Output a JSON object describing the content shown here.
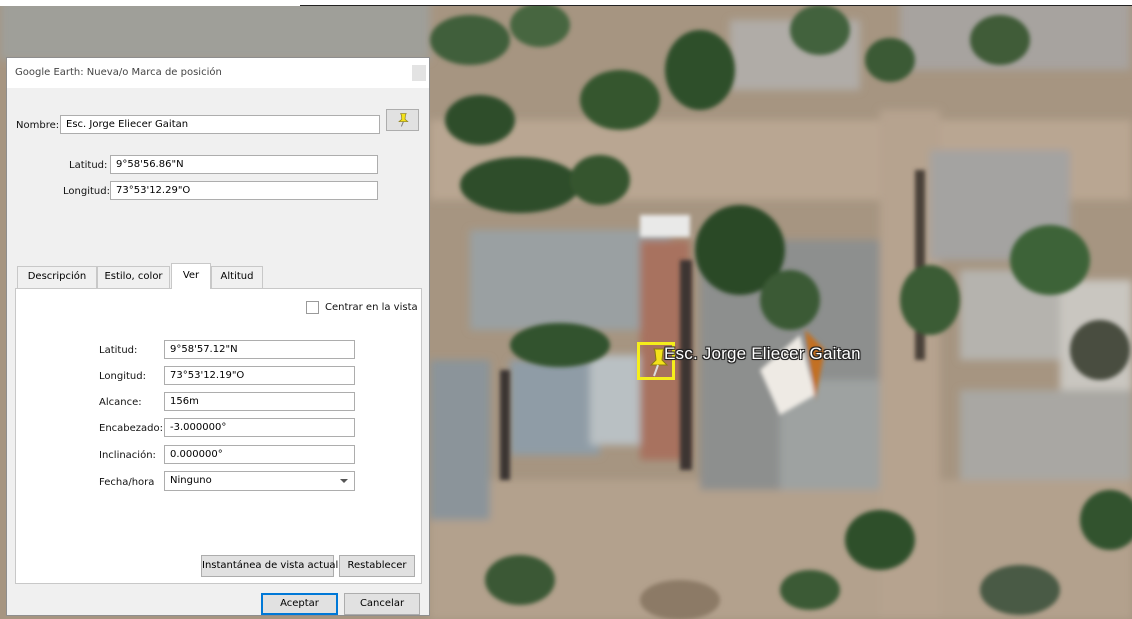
{
  "dialog": {
    "title": "Google Earth: Nueva/o Marca de posición",
    "name_label": "Nombre:",
    "name_value": "Esc. Jorge Eliecer Gaitan",
    "pin_icon": "yellow-pushpin-icon",
    "lat_label": "Latitud:",
    "lat_value": "9°58'56.86\"N",
    "lon_label": "Longitud:",
    "lon_value": "73°53'12.29\"O",
    "tabs": [
      {
        "label": "Descripción"
      },
      {
        "label": "Estilo, color"
      },
      {
        "label": "Ver"
      },
      {
        "label": "Altitud"
      }
    ],
    "active_tab": "Ver",
    "view": {
      "center_label": "Centrar en la vista",
      "center_checked": false,
      "lat_label": "Latitud:",
      "lat_value": "9°58'57.12\"N",
      "lon_label": "Longitud:",
      "lon_value": "73°53'12.19\"O",
      "range_label": "Alcance:",
      "range_value": "156m",
      "heading_label": "Encabezado:",
      "heading_value": "-3.000000°",
      "tilt_label": "Inclinación:",
      "tilt_value": "0.000000°",
      "datetime_label": "Fecha/hora",
      "datetime_value": "Ninguno",
      "snapshot_label": "Instantánea de vista actual",
      "reset_label": "Restablecer"
    },
    "ok_label": "Aceptar",
    "cancel_label": "Cancelar"
  },
  "map": {
    "placemark_label": "Esc. Jorge Eliecer Gaitan",
    "placemark_icon": "yellow-pushpin-icon",
    "highlight_color": "#f5ee1c"
  }
}
